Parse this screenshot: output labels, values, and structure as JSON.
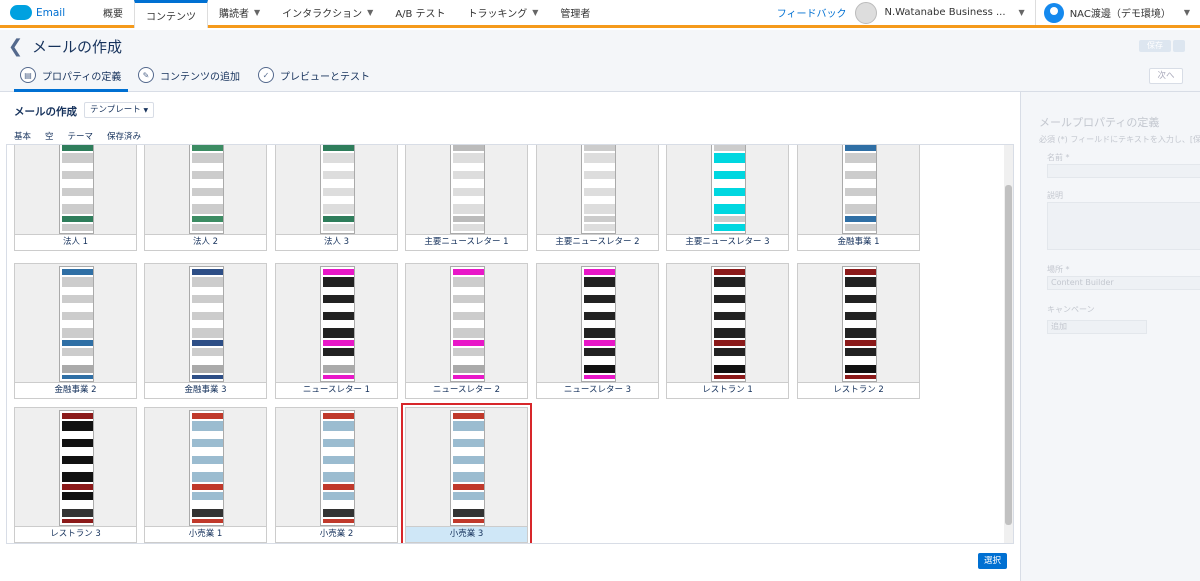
{
  "brand": {
    "name": "Email"
  },
  "nav": {
    "items": [
      "概要",
      "コンテンツ",
      "購読者",
      "インタラクション",
      "A/B テスト",
      "トラッキング",
      "管理者"
    ],
    "feedback": "フィードバック",
    "account": "N.Watanabe Business ...",
    "user": "NAC渡邊（デモ環境）"
  },
  "header": {
    "title": "メールの作成",
    "save_label": "保存"
  },
  "steps": [
    "プロパティの定義",
    "コンテンツの追加",
    "プレビューとテスト"
  ],
  "next_label": "次へ",
  "main": {
    "title": "メールの作成",
    "template_dropdown": "テンプレート",
    "subtabs": [
      "基本",
      "空",
      "テーマ",
      "保存済み"
    ],
    "select_label": "選択",
    "templates": [
      {
        "name": "法人 1"
      },
      {
        "name": "法人 2"
      },
      {
        "name": "法人 3"
      },
      {
        "name": "主要ニュースレター 1"
      },
      {
        "name": "主要ニュースレター 2"
      },
      {
        "name": "主要ニュースレター 3"
      },
      {
        "name": "金融事業 1"
      },
      {
        "name": "金融事業 2"
      },
      {
        "name": "金融事業 3"
      },
      {
        "name": "ニュースレター 1"
      },
      {
        "name": "ニュースレター 2"
      },
      {
        "name": "ニュースレター 3"
      },
      {
        "name": "レストラン 1"
      },
      {
        "name": "レストラン 2"
      },
      {
        "name": "レストラン 3"
      },
      {
        "name": "小売業 1"
      },
      {
        "name": "小売業 2"
      },
      {
        "name": "小売業 3",
        "selected": true
      }
    ]
  },
  "side": {
    "title": "メールプロパティの定義",
    "help": "必須 (*) フィールドにテキストを入力し、[保",
    "name_label": "名前 *",
    "desc_label": "説明",
    "location_label": "場所 *",
    "location_value": "Content Builder",
    "campaign_label": "キャンペーン",
    "campaign_value": "追加"
  }
}
